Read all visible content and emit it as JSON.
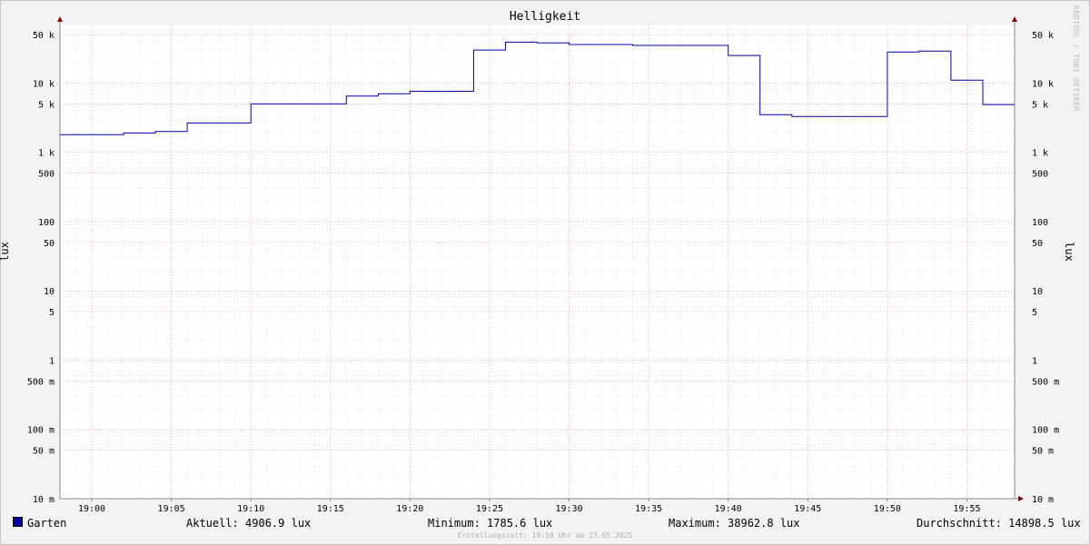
{
  "chart_data": {
    "type": "line",
    "title": "Helligkeit",
    "ylabel": "lux",
    "ylabel_right": "lux",
    "y_scale": "log",
    "ylim": [
      0.01,
      70000
    ],
    "xlim": [
      "18:58",
      "19:58"
    ],
    "x_ticks": [
      "19:00",
      "19:05",
      "19:10",
      "19:15",
      "19:20",
      "19:25",
      "19:30",
      "19:35",
      "19:40",
      "19:45",
      "19:50",
      "19:55"
    ],
    "y_ticks": [
      {
        "value": 50000,
        "label": "50 k"
      },
      {
        "value": 10000,
        "label": "10 k"
      },
      {
        "value": 5000,
        "label": "5 k"
      },
      {
        "value": 1000,
        "label": "1 k"
      },
      {
        "value": 500,
        "label": "500"
      },
      {
        "value": 100,
        "label": "100"
      },
      {
        "value": 50,
        "label": "50"
      },
      {
        "value": 10,
        "label": "10"
      },
      {
        "value": 5,
        "label": "5"
      },
      {
        "value": 1,
        "label": "1"
      },
      {
        "value": 0.5,
        "label": "500 m"
      },
      {
        "value": 0.1,
        "label": "100 m"
      },
      {
        "value": 0.05,
        "label": "50 m"
      },
      {
        "value": 0.01,
        "label": "10 m"
      }
    ],
    "grid": true,
    "series": [
      {
        "name": "Garten",
        "color": "#0000aa",
        "step": true,
        "x": [
          "18:58",
          "19:02",
          "19:04",
          "19:06",
          "19:10",
          "19:16",
          "19:18",
          "19:20",
          "19:24",
          "19:26",
          "19:28",
          "19:30",
          "19:34",
          "19:40",
          "19:42",
          "19:44",
          "19:50",
          "19:52",
          "19:54",
          "19:56"
        ],
        "y": [
          1800,
          1900,
          2000,
          2650,
          5000,
          6500,
          7000,
          7600,
          30000,
          39000,
          38000,
          36000,
          35000,
          25000,
          3500,
          3300,
          28000,
          29000,
          11000,
          4900
        ],
        "x_end": "19:58"
      }
    ]
  },
  "legend": {
    "series_name": "Garten",
    "current": "Aktuell: 4906.9 lux",
    "minimum": "Minimum: 1785.6 lux",
    "maximum": "Maximum: 38962.8 lux",
    "average": "Durchschnitt: 14898.5 lux"
  },
  "watermark": "RRDTOOL / TOBI OETIKER",
  "footer": "Erstellungszeit: 19:58 Uhr am 23.05.2025"
}
